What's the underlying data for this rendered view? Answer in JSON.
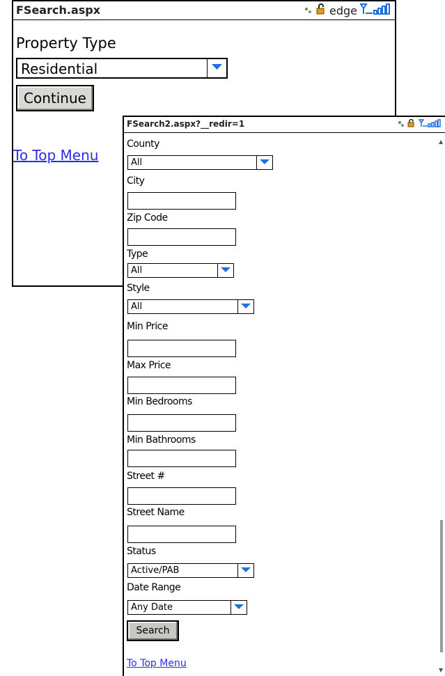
{
  "screen1": {
    "title": "FSearch.aspx",
    "status": {
      "network": "edge"
    },
    "property_type_label": "Property Type",
    "property_type_value": "Residential",
    "continue_label": "Continue",
    "top_menu_link": "To Top Menu"
  },
  "screen2": {
    "title": "FSearch2.aspx?__redir=1",
    "fields": {
      "county_label": "County",
      "county_value": "All",
      "city_label": "City",
      "zip_label": "Zip Code",
      "type_label": "Type",
      "type_value": "All",
      "style_label": "Style",
      "style_value": "All",
      "min_price_label": "Min Price",
      "max_price_label": "Max Price",
      "min_bedrooms_label": "Min Bedrooms",
      "min_bathrooms_label": "Min Bathrooms",
      "street_num_label": "Street #",
      "street_name_label": "Street Name",
      "status_label": "Status",
      "status_value": "Active/PAB",
      "date_range_label": "Date Range",
      "date_range_value": "Any Date"
    },
    "search_label": "Search",
    "top_menu_link": "To Top Menu"
  },
  "colors": {
    "link": "#2a2aee",
    "dropdown_arrow": "#1e6fe0",
    "signal": "#1e6fe0"
  },
  "icons": [
    "network-icon",
    "lock-icon",
    "signal-icon",
    "dropdown-arrow-icon"
  ]
}
